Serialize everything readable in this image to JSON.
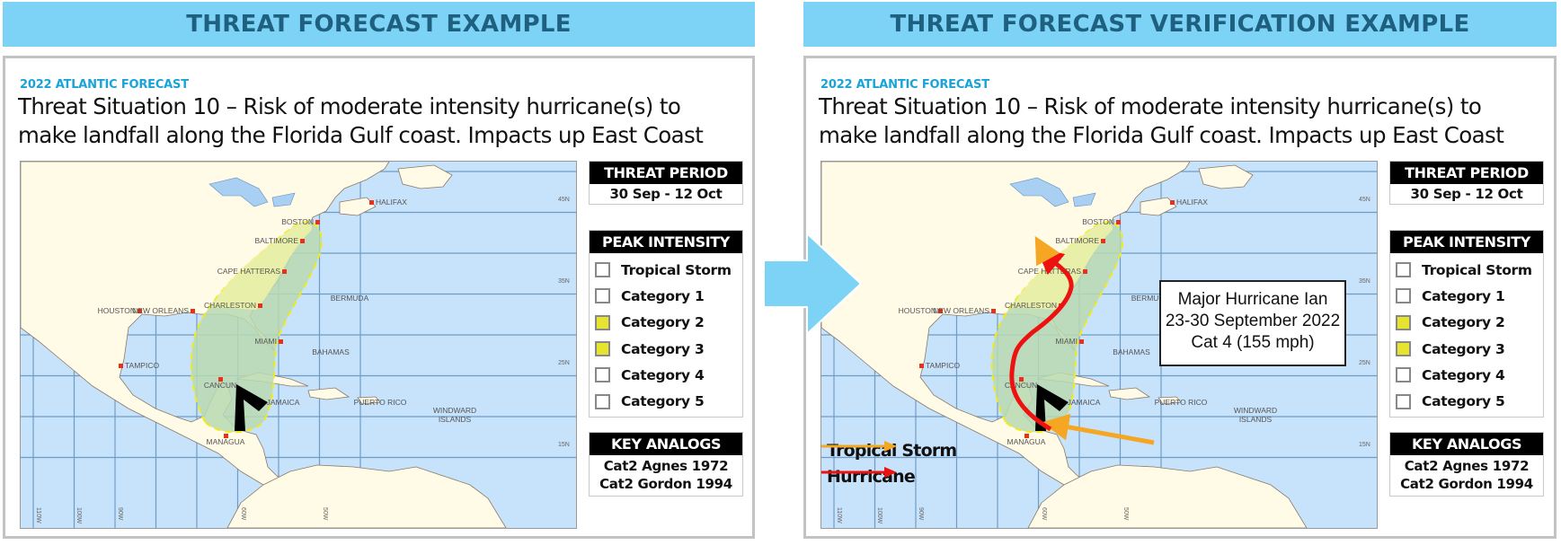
{
  "left": {
    "banner_title": "THREAT FORECAST EXAMPLE",
    "kicker": "2022 ATLANTIC FORECAST",
    "headline_line1": "Threat Situation 10 – Risk of moderate intensity hurricane(s) to",
    "headline_line2": "make landfall along the Florida Gulf coast. Impacts up East Coast",
    "threat_period": {
      "title": "THREAT PERIOD",
      "value": "30 Sep - 12 Oct"
    },
    "peak_intensity": {
      "title": "PEAK INTENSITY",
      "items": [
        {
          "label": "Tropical Storm",
          "checked": false
        },
        {
          "label": "Category 1",
          "checked": false
        },
        {
          "label": "Category 2",
          "checked": true
        },
        {
          "label": "Category 3",
          "checked": true
        },
        {
          "label": "Category 4",
          "checked": false
        },
        {
          "label": "Category 5",
          "checked": false
        }
      ]
    },
    "key_analogs": {
      "title": "KEY ANALOGS",
      "items": [
        "Cat2 Agnes 1972",
        "Cat2 Gordon 1994"
      ]
    }
  },
  "right": {
    "banner_title": "THREAT FORECAST VERIFICATION EXAMPLE",
    "kicker": "2022 ATLANTIC FORECAST",
    "headline_line1": "Threat Situation 10 – Risk of moderate intensity hurricane(s) to",
    "headline_line2": "make landfall along the Florida Gulf coast. Impacts up East Coast",
    "threat_period": {
      "title": "THREAT PERIOD",
      "value": "30 Sep - 12 Oct"
    },
    "peak_intensity": {
      "title": "PEAK INTENSITY",
      "items": [
        {
          "label": "Tropical Storm",
          "checked": false
        },
        {
          "label": "Category 1",
          "checked": false
        },
        {
          "label": "Category 2",
          "checked": true
        },
        {
          "label": "Category 3",
          "checked": true
        },
        {
          "label": "Category 4",
          "checked": false
        },
        {
          "label": "Category 5",
          "checked": false
        }
      ]
    },
    "key_analogs": {
      "title": "KEY ANALOGS",
      "items": [
        "Cat2 Agnes 1972",
        "Cat2 Gordon 1994"
      ]
    },
    "callout": {
      "line1": "Major Hurricane Ian",
      "line2": "23-30 September 2022",
      "line3": "Cat 4 (155 mph)"
    },
    "legend": [
      {
        "label": "Tropical Storm",
        "color": "#f5a623"
      },
      {
        "label": "Hurricane",
        "color": "#ee1111"
      }
    ]
  },
  "map": {
    "cities": [
      "HALIFAX",
      "BOSTON",
      "BALTIMORE",
      "CAPE HATTERAS",
      "CHARLESTON",
      "BERMUDA",
      "HOUSTON",
      "NEW ORLEANS",
      "TAMPICO",
      "MIAMI",
      "BAHAMAS",
      "CANCUN",
      "JAMAICA",
      "PUERTO RICO",
      "WINDWARD",
      "ISLANDS",
      "MANAGUA"
    ],
    "lat_labels": [
      "45N",
      "35N",
      "25N",
      "15N"
    ],
    "lon_labels": [
      "110W",
      "100W",
      "90W",
      "60W",
      "50W"
    ]
  },
  "colors": {
    "banner": "#7dd3f5",
    "banner_text": "#1f5f7f",
    "kicker": "#1aa3d9",
    "ocean": "#c7e2fb",
    "land": "#fffbe6",
    "cone_land": "#eef2a6",
    "cone_sea": "#b9d9b0",
    "cone_border": "#f2ea1a",
    "checked_box": "#e6e42e"
  }
}
